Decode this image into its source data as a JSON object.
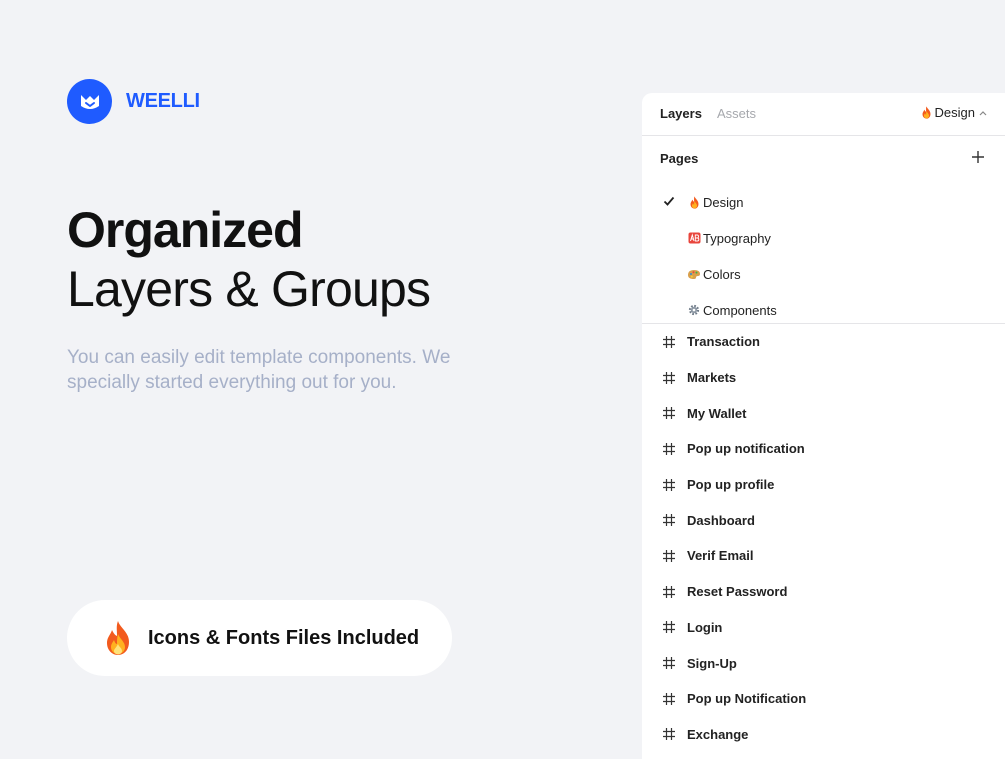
{
  "brand": {
    "name": "WEELLI",
    "logo_icon": "weelli-logo-icon",
    "color": "#1f5bff"
  },
  "hero": {
    "title_bold": "Organized",
    "title_regular": "Layers & Groups",
    "subtitle": "You can easily edit template components. We specially started everything out for you."
  },
  "badge": {
    "icon": "fire-icon",
    "text": "Icons & Fonts Files Included"
  },
  "panel": {
    "tabs": {
      "layers": "Layers",
      "assets": "Assets"
    },
    "current_page": "Design",
    "pages_title": "Pages",
    "pages": [
      {
        "label": "Design",
        "icon": "fire-icon",
        "selected": true
      },
      {
        "label": "Typography",
        "icon": "ab-icon",
        "selected": false
      },
      {
        "label": "Colors",
        "icon": "palette-icon",
        "selected": false
      },
      {
        "label": "Components",
        "icon": "gear-icon",
        "selected": false
      }
    ],
    "frames": [
      "Transaction",
      "Markets",
      "My Wallet",
      "Pop up notification",
      "Pop up profile",
      "Dashboard",
      "Verif Email",
      "Reset Password",
      "Login",
      "Sign-Up",
      "Pop up Notification",
      "Exchange"
    ]
  }
}
